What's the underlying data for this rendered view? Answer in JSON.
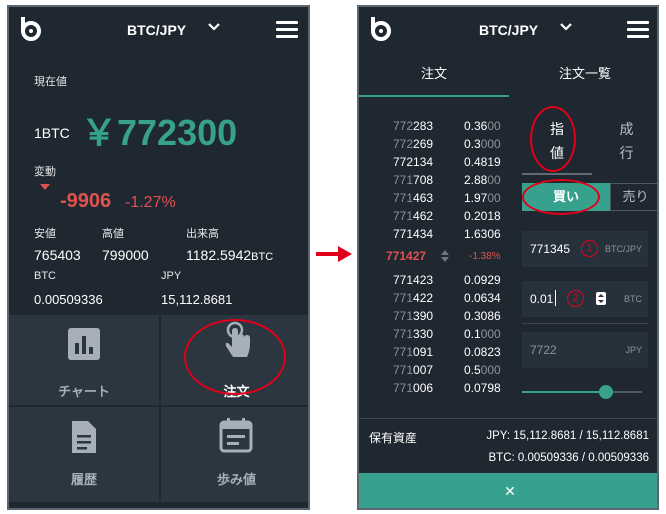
{
  "colors": {
    "bg": "#1f2730",
    "accent": "#37a18e",
    "down": "#e0524f",
    "annot": "#e0001a"
  },
  "left": {
    "pair": "BTC/JPY",
    "current_label": "現在値",
    "unit": "1BTC",
    "price": "￥772300",
    "change_label": "変動",
    "change_value": "-9906",
    "change_pct": "-1.27%",
    "stats": [
      {
        "label": "安値",
        "value": "765403"
      },
      {
        "label": "高値",
        "value": "799000"
      },
      {
        "label": "出来高",
        "value": "1182.5942",
        "unit": "BTC"
      }
    ],
    "balances": [
      {
        "label": "BTC",
        "value": "0.00509336"
      },
      {
        "label": "JPY",
        "value": "15,112.8681"
      }
    ],
    "tiles": [
      {
        "label": "チャート",
        "icon": "bar-chart-icon"
      },
      {
        "label": "注文",
        "icon": "hand-tap-icon"
      },
      {
        "label": "履歴",
        "icon": "document-icon"
      },
      {
        "label": "歩み値",
        "icon": "calendar-icon"
      }
    ]
  },
  "right": {
    "pair": "BTC/JPY",
    "tabs": [
      "注文",
      "注文一覧"
    ],
    "order_types": [
      "指値",
      "成行"
    ],
    "sides": [
      "買い",
      "売り"
    ],
    "orderbook_sell": [
      {
        "dim": "772",
        "bright": "283",
        "qty_bright": "0.36",
        "qty_dim": "00"
      },
      {
        "dim": "772",
        "bright": "269",
        "qty_bright": "0.3",
        "qty_dim": "000"
      },
      {
        "dim": "",
        "bright": "772134",
        "qty_bright": "0.4819",
        "qty_dim": ""
      },
      {
        "dim": "771",
        "bright": "708",
        "qty_bright": "2.88",
        "qty_dim": "00"
      },
      {
        "dim": "771",
        "bright": "463",
        "qty_bright": "1.97",
        "qty_dim": "00"
      },
      {
        "dim": "771",
        "bright": "462",
        "qty_bright": "0.2018",
        "qty_dim": ""
      },
      {
        "dim": "",
        "bright": "771434",
        "qty_bright": "1.6306",
        "qty_dim": ""
      }
    ],
    "mid_price": "771427",
    "mid_pct": "-1.38%",
    "orderbook_buy": [
      {
        "dim": "",
        "bright": "771423",
        "qty_bright": "0.0929",
        "qty_dim": ""
      },
      {
        "dim": "771",
        "bright": "422",
        "qty_bright": "0.0634",
        "qty_dim": ""
      },
      {
        "dim": "771",
        "bright": "390",
        "qty_bright": "0.3086",
        "qty_dim": ""
      },
      {
        "dim": "771",
        "bright": "330",
        "qty_bright": "0.1",
        "qty_dim": "000"
      },
      {
        "dim": "771",
        "bright": "091",
        "qty_bright": "0.0823",
        "qty_dim": ""
      },
      {
        "dim": "771",
        "bright": "007",
        "qty_bright": "0.5",
        "qty_dim": "000"
      },
      {
        "dim": "771",
        "bright": "006",
        "qty_bright": "0.0798",
        "qty_dim": ""
      }
    ],
    "price_input": {
      "value": "771345",
      "unit": "BTC/JPY",
      "marker": "1"
    },
    "amount_input": {
      "value": "0.01",
      "unit": "BTC",
      "marker": "2"
    },
    "total": {
      "value": "7722",
      "unit": "JPY"
    },
    "slider_value": 0.7,
    "assets_label": "保有資産",
    "assets_jpy": "JPY: 15,112.8681 / 15,112.8681",
    "assets_btc": "BTC: 0.00509336 / 0.00509336",
    "close_glyph": "✕"
  }
}
